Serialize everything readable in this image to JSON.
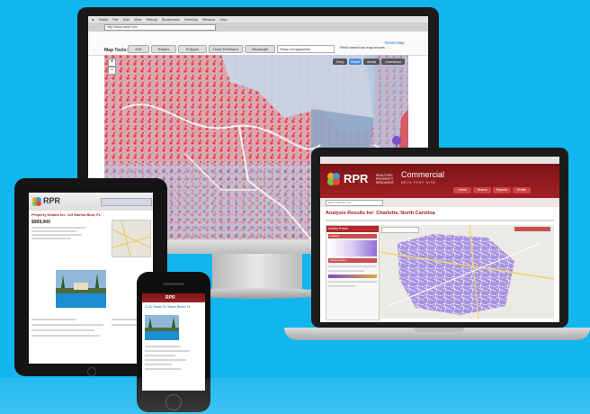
{
  "imac": {
    "menu_items": [
      "Safari",
      "File",
      "Edit",
      "View",
      "History",
      "Bookmarks",
      "Develop",
      "Window",
      "Help"
    ],
    "url": "http://www.narrpr.com",
    "map_tools_label": "Map Tools:",
    "tool_buttons": [
      "Edit",
      "Radius",
      "Polygon",
      "Draw Freehand",
      "Rectangle"
    ],
    "geographies_select": "Show Geographies",
    "reset_map": "Reset Map",
    "search_as_move": "Redo search as map moves",
    "map_type_buttons": [
      "Grey",
      "Road",
      "Aerial",
      "Overhead"
    ]
  },
  "laptop": {
    "logo": "RPR",
    "brand_small": "REALTORS PROPERTY RESOURCE",
    "brand_title": "Commercial",
    "brand_sub": "BETA TEST SITE",
    "nav_tabs": [
      "Home",
      "Search",
      "Reports",
      "Profile"
    ],
    "search_placeholder": "Enter Address, City",
    "results_title": "Analysis Results for: Charlotte, North Carolina",
    "panel_title": "Activity Points",
    "panel_sections": [
      "Legend",
      "Opportunities"
    ]
  },
  "tablet": {
    "logo": "RPR",
    "result_title": "Property Details for: 123 Marina Blvd, FL",
    "price": "$999,000"
  },
  "phone": {
    "nav_title": "RPR",
    "property_label": "2125 Ocean Dr, Miami Beach FL"
  },
  "colors": {
    "background": "#12b6ef",
    "rpr_red": "#a32023",
    "map_red": "#d9454f",
    "map_blue": "#5b8fd0",
    "map_purple": "#9a8ad9"
  }
}
